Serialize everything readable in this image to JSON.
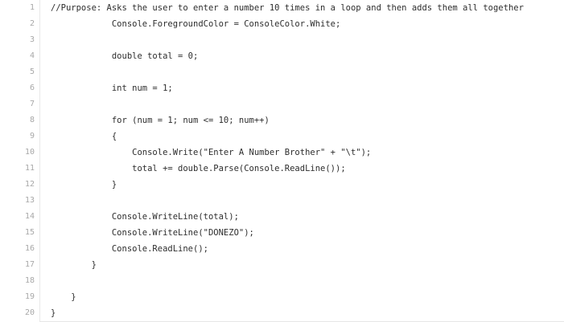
{
  "lines": [
    {
      "number": "1",
      "text": "//Purpose: Asks the user to enter a number 10 times in a loop and then adds them all together"
    },
    {
      "number": "2",
      "text": "            Console.ForegroundColor = ConsoleColor.White;"
    },
    {
      "number": "3",
      "text": ""
    },
    {
      "number": "4",
      "text": "            double total = 0;"
    },
    {
      "number": "5",
      "text": ""
    },
    {
      "number": "6",
      "text": "            int num = 1;"
    },
    {
      "number": "7",
      "text": ""
    },
    {
      "number": "8",
      "text": "            for (num = 1; num <= 10; num++)"
    },
    {
      "number": "9",
      "text": "            {"
    },
    {
      "number": "10",
      "text": "                Console.Write(\"Enter A Number Brother\" + \"\\t\");"
    },
    {
      "number": "11",
      "text": "                total += double.Parse(Console.ReadLine());"
    },
    {
      "number": "12",
      "text": "            }"
    },
    {
      "number": "13",
      "text": ""
    },
    {
      "number": "14",
      "text": "            Console.WriteLine(total);"
    },
    {
      "number": "15",
      "text": "            Console.WriteLine(\"DONEZO\");"
    },
    {
      "number": "16",
      "text": "            Console.ReadLine();"
    },
    {
      "number": "17",
      "text": "        }"
    },
    {
      "number": "18",
      "text": ""
    },
    {
      "number": "19",
      "text": "    }"
    },
    {
      "number": "20",
      "text": "}"
    }
  ]
}
